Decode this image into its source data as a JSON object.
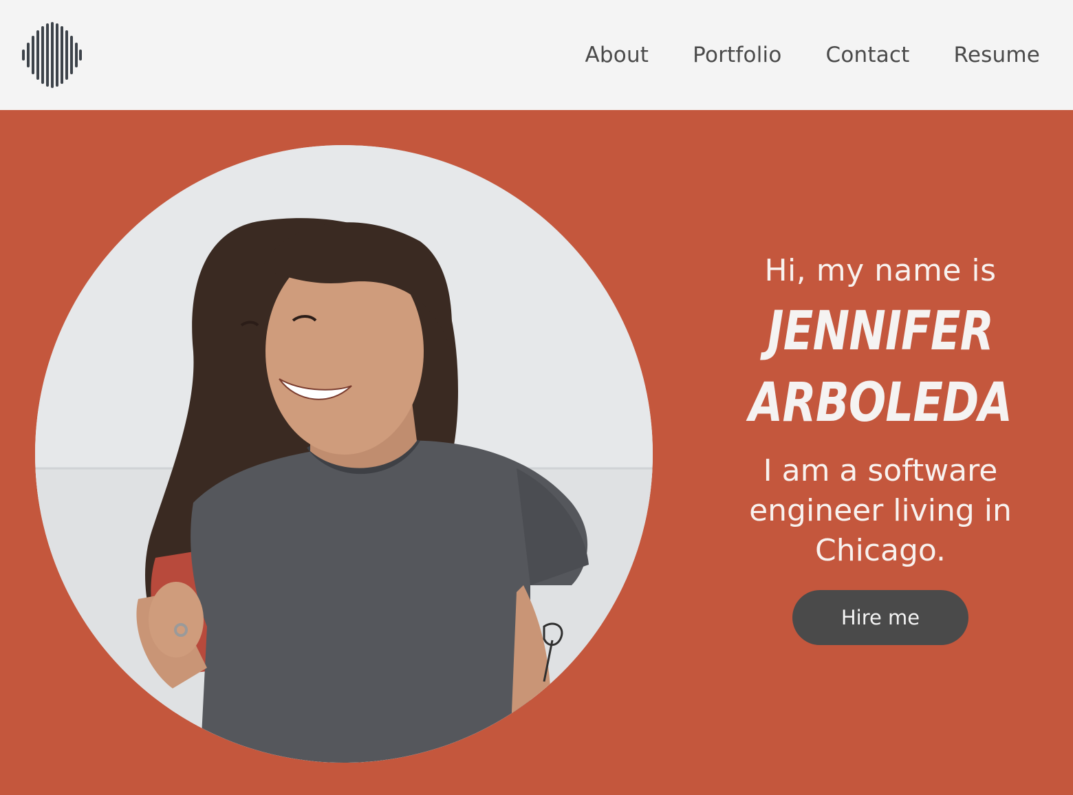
{
  "header": {
    "logo_icon": "waveform-logo-icon",
    "nav": [
      {
        "label": "About"
      },
      {
        "label": "Portfolio"
      },
      {
        "label": "Contact"
      },
      {
        "label": "Resume"
      }
    ]
  },
  "hero": {
    "greeting": "Hi, my name is",
    "name_line1": "Jennifer",
    "name_line2": "Arboleda",
    "tagline_line1": "I am a software",
    "tagline_line2": "engineer living in",
    "tagline_line3": "Chicago.",
    "cta_label": "Hire me"
  },
  "colors": {
    "background": "#c4573d",
    "header_bg": "#f4f4f4",
    "nav_text": "#4a4a4a",
    "button_bg": "#4a4a4a",
    "hero_text": "#f8f2ef"
  }
}
